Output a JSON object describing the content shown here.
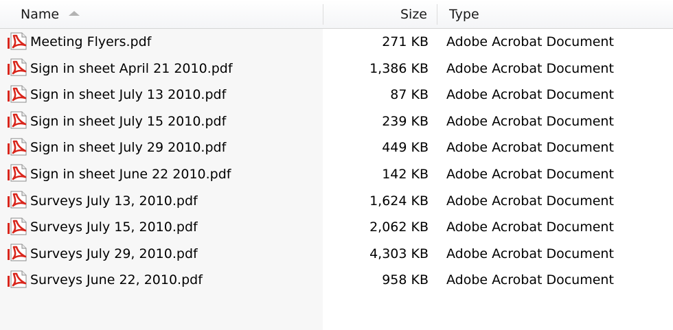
{
  "columns": {
    "name": "Name",
    "size": "Size",
    "type": "Type"
  },
  "colors": {
    "icon_red": "#d9261c",
    "header_text": "#1a1a1a",
    "sort_arrow": "#b3b3b3"
  },
  "icons": {
    "file": "pdf-file-icon",
    "sort": "sort-ascending-arrow"
  },
  "files": [
    {
      "name": "Meeting Flyers.pdf",
      "size": "271 KB",
      "type": "Adobe Acrobat Document"
    },
    {
      "name": "Sign in sheet April 21 2010.pdf",
      "size": "1,386 KB",
      "type": "Adobe Acrobat Document"
    },
    {
      "name": "Sign in sheet July 13 2010.pdf",
      "size": "87 KB",
      "type": "Adobe Acrobat Document"
    },
    {
      "name": "Sign in sheet July 15 2010.pdf",
      "size": "239 KB",
      "type": "Adobe Acrobat Document"
    },
    {
      "name": "Sign in sheet July 29 2010.pdf",
      "size": "449 KB",
      "type": "Adobe Acrobat Document"
    },
    {
      "name": "Sign in sheet June 22 2010.pdf",
      "size": "142 KB",
      "type": "Adobe Acrobat Document"
    },
    {
      "name": "Surveys July 13, 2010.pdf",
      "size": "1,624 KB",
      "type": "Adobe Acrobat Document"
    },
    {
      "name": "Surveys July 15, 2010.pdf",
      "size": "2,062 KB",
      "type": "Adobe Acrobat Document"
    },
    {
      "name": "Surveys July 29, 2010.pdf",
      "size": "4,303 KB",
      "type": "Adobe Acrobat Document"
    },
    {
      "name": "Surveys June 22, 2010.pdf",
      "size": "958 KB",
      "type": "Adobe Acrobat Document"
    }
  ]
}
